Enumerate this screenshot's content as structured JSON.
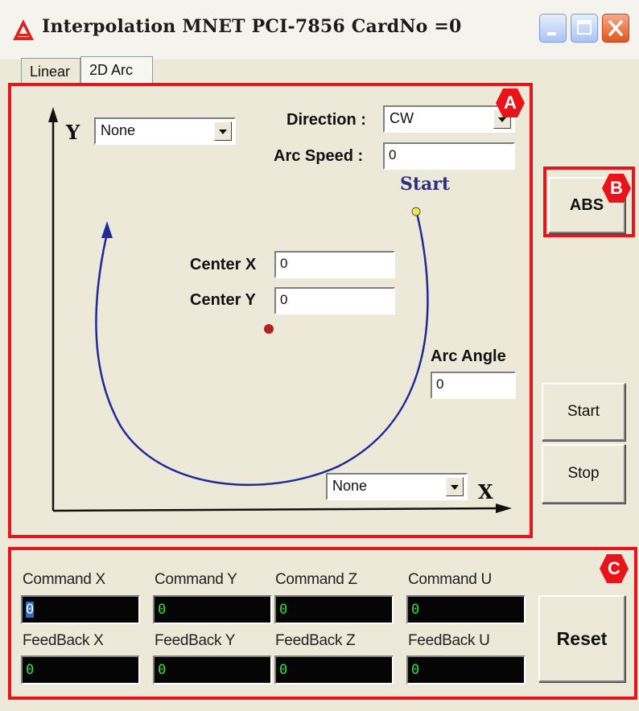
{
  "window": {
    "title": "Interpolation MNET PCI-7856 CardNo =0",
    "controls": [
      "minimize",
      "maximize",
      "close"
    ]
  },
  "tabs": [
    {
      "label": "Linear",
      "active": false
    },
    {
      "label": "2D Arc",
      "active": true
    }
  ],
  "arc_panel": {
    "y_axis_label": "Y",
    "x_axis_label": "X",
    "y_axis_select": "None",
    "x_axis_select": "None",
    "direction_label": "Direction :",
    "direction_value": "CW",
    "arc_speed_label": "Arc Speed :",
    "arc_speed_value": "0",
    "start_label": "Start",
    "center_x_label": "Center X",
    "center_x_value": "0",
    "center_y_label": "Center Y",
    "center_y_value": "0",
    "arc_angle_label": "Arc Angle",
    "arc_angle_value": "0"
  },
  "side_buttons": {
    "abs": "ABS",
    "start": "Start",
    "stop": "Stop"
  },
  "readouts": [
    {
      "label": "Command X",
      "value": "0",
      "selected": true
    },
    {
      "label": "Command Y",
      "value": "0",
      "selected": false
    },
    {
      "label": "Command Z",
      "value": "0",
      "selected": false
    },
    {
      "label": "Command U",
      "value": "0",
      "selected": false
    },
    {
      "label": "FeedBack X",
      "value": "0",
      "selected": false
    },
    {
      "label": "FeedBack Y",
      "value": "0",
      "selected": false
    },
    {
      "label": "FeedBack Z",
      "value": "0",
      "selected": false
    },
    {
      "label": "FeedBack U",
      "value": "0",
      "selected": false
    }
  ],
  "reset_button": "Reset",
  "annotations": {
    "a": "A",
    "b": "B",
    "c": "C",
    "color": "#e8141a"
  },
  "colors": {
    "arc": "#1f2a9a",
    "start_point": "#f2e84a",
    "center_point": "#b22222",
    "readout_text": "#2ee52e"
  }
}
